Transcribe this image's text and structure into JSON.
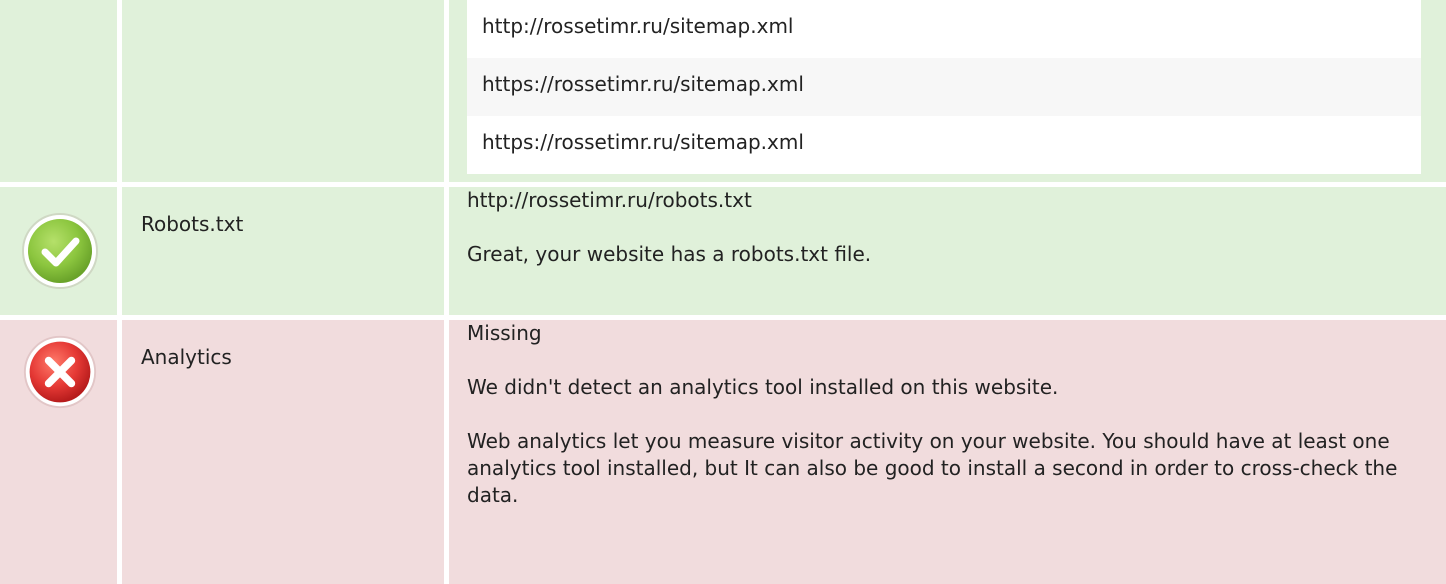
{
  "sitemaps": {
    "urls": [
      "http://rossetimr.ru/sitemap.xml",
      "https://rossetimr.ru/sitemap.xml",
      "https://rossetimr.ru/sitemap.xml"
    ],
    "status_color": "#e0f1da"
  },
  "robots": {
    "status": "pass",
    "status_icon": "check-circle-icon",
    "label": "Robots.txt",
    "url": "http://rossetimr.ru/robots.txt",
    "message": "Great, your website has a robots.txt file.",
    "status_color": "#e0f1da",
    "icon_color": "#8cc63f"
  },
  "analytics": {
    "status": "fail",
    "status_icon": "close-circle-icon",
    "label": "Analytics",
    "value": "Missing",
    "message": "We didn't detect an analytics tool installed on this website.",
    "description": "Web analytics let you measure visitor activity on your website. You should have at least one analytics tool installed, but It can also be good to install a second in order to cross-check the data.",
    "status_color": "#f1dcdd",
    "icon_color": "#e53935"
  }
}
